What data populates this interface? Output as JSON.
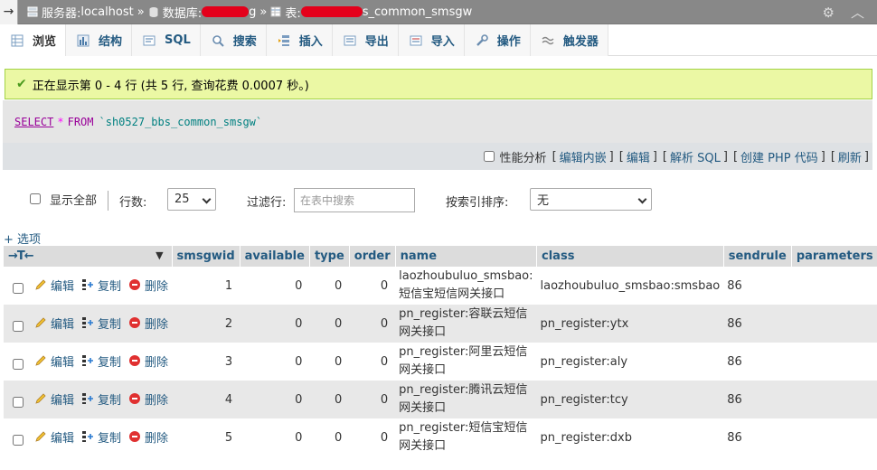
{
  "breadcrumb": {
    "back_arrow": "→",
    "server_label": "服务器:",
    "server_value": "localhost",
    "db_label": "数据库:",
    "db_suffix": "g",
    "table_label": "表:",
    "table_suffix": "s_common_smsgw",
    "separator": "»"
  },
  "tabs": [
    {
      "label": "浏览",
      "icon": "browse-icon",
      "active": true
    },
    {
      "label": "结构",
      "icon": "structure-icon"
    },
    {
      "label": "SQL",
      "icon": "sql-icon"
    },
    {
      "label": "搜索",
      "icon": "search-icon"
    },
    {
      "label": "插入",
      "icon": "insert-icon"
    },
    {
      "label": "导出",
      "icon": "export-icon"
    },
    {
      "label": "导入",
      "icon": "import-icon"
    },
    {
      "label": "操作",
      "icon": "wrench-icon"
    },
    {
      "label": "触发器",
      "icon": "trigger-icon"
    }
  ],
  "message": {
    "text": "正在显示第 0 - 4 行 (共 5 行, 查询花费 0.0007 秒。)"
  },
  "sql": {
    "select": "SELECT",
    "star": "*",
    "from": "FROM",
    "table": "`sh0527_bbs_common_smsgw`"
  },
  "links": {
    "profiling": "性能分析",
    "inline_edit": "编辑内嵌",
    "edit": "编辑",
    "explain": "解析 SQL",
    "create_php": "创建 PHP 代码",
    "refresh": "刷新"
  },
  "nav": {
    "show_all": "显示全部",
    "rows_label": "行数:",
    "rows_value": "25",
    "filter_label": "过滤行:",
    "filter_placeholder": "在表中搜索",
    "sort_label": "按索引排序:",
    "sort_value": "无"
  },
  "options_link": "+ 选项",
  "table": {
    "arrows": "→T←",
    "columns": [
      "smsgwid",
      "available",
      "type",
      "order",
      "name",
      "class",
      "sendrule",
      "parameters"
    ],
    "actions": {
      "edit": "编辑",
      "copy": "复制",
      "delete": "删除"
    },
    "rows": [
      {
        "smsgwid": "1",
        "available": "0",
        "type": "0",
        "order": "0",
        "name": "laozhoubuluo_smsbao:短信宝短信网关接口",
        "class": "laozhoubuluo_smsbao:smsbao",
        "sendrule": "86",
        "parameters": ""
      },
      {
        "smsgwid": "2",
        "available": "0",
        "type": "0",
        "order": "0",
        "name": "pn_register:容联云短信网关接口",
        "class": "pn_register:ytx",
        "sendrule": "86",
        "parameters": ""
      },
      {
        "smsgwid": "3",
        "available": "0",
        "type": "0",
        "order": "0",
        "name": "pn_register:阿里云短信网关接口",
        "class": "pn_register:aly",
        "sendrule": "86",
        "parameters": ""
      },
      {
        "smsgwid": "4",
        "available": "0",
        "type": "0",
        "order": "0",
        "name": "pn_register:腾讯云短信网关接口",
        "class": "pn_register:tcy",
        "sendrule": "86",
        "parameters": ""
      },
      {
        "smsgwid": "5",
        "available": "0",
        "type": "0",
        "order": "0",
        "name": "pn_register:短信宝短信网关接口",
        "class": "pn_register:dxb",
        "sendrule": "86",
        "parameters": ""
      }
    ]
  },
  "colors": {
    "link": "#235a81",
    "success_bg": "#ebf8a4",
    "redaction": "#e4001b"
  }
}
